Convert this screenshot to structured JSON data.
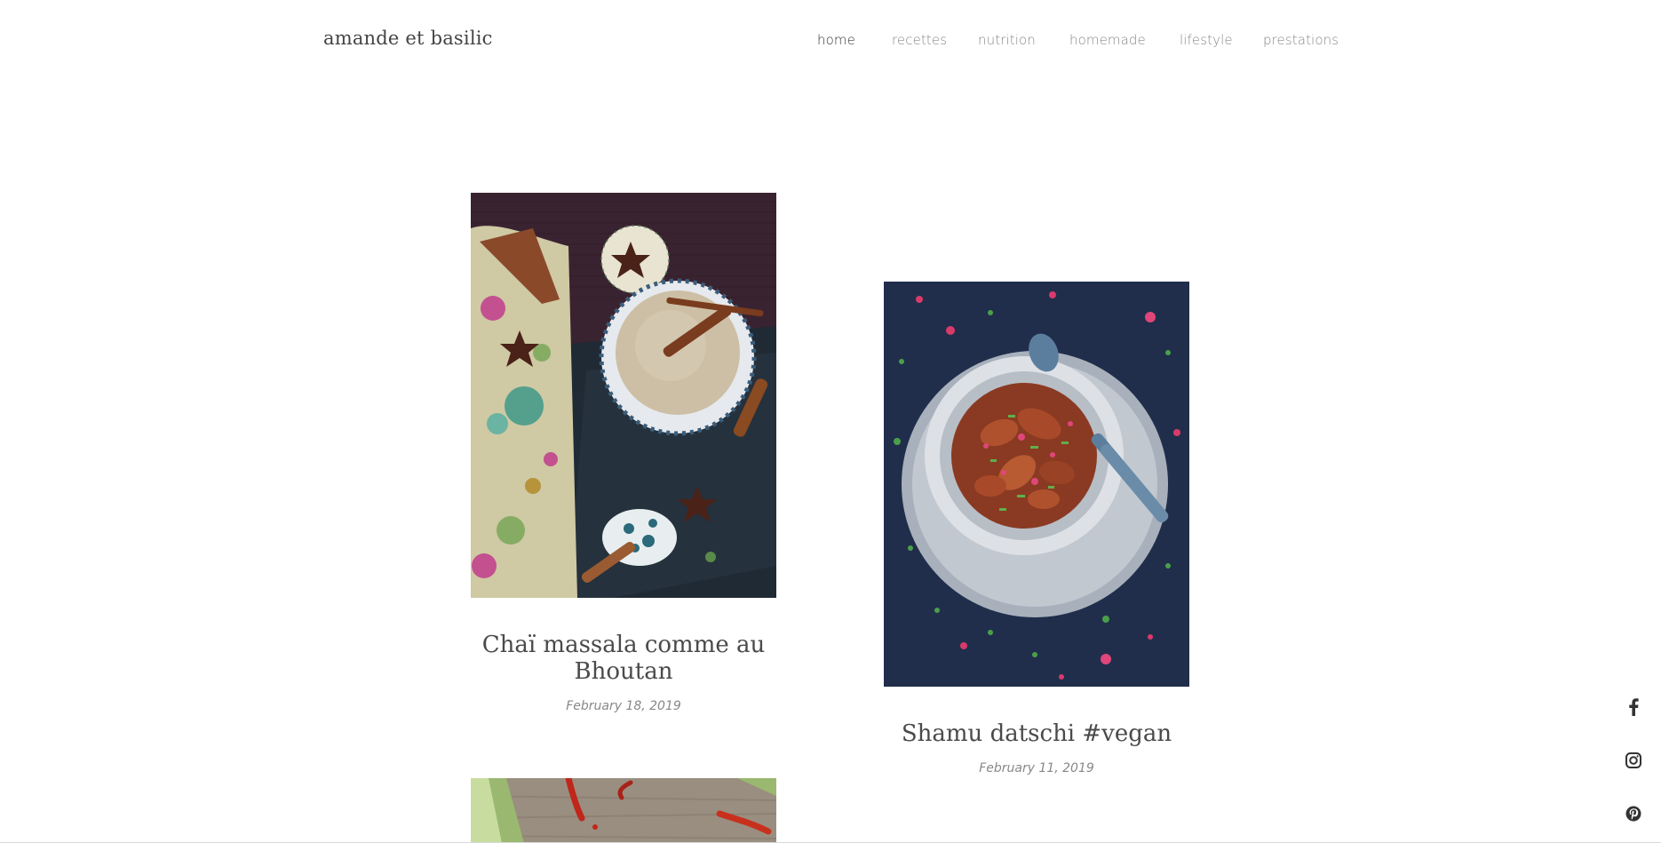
{
  "site": {
    "title": "amande et basilic"
  },
  "nav": {
    "items": [
      {
        "label": "home",
        "active": true
      },
      {
        "label": "recettes"
      },
      {
        "label": "nutrition"
      },
      {
        "label": "homemade"
      },
      {
        "label": "lifestyle"
      },
      {
        "label": "prestations"
      }
    ]
  },
  "posts": [
    {
      "title": "Chaï massala comme au Bhoutan",
      "date": "February 18, 2019"
    },
    {
      "title": "Shamu datschi #vegan",
      "date": "February 11, 2019"
    }
  ],
  "social": [
    {
      "icon": "facebook-icon"
    },
    {
      "icon": "instagram-icon"
    },
    {
      "icon": "pinterest-icon"
    }
  ]
}
